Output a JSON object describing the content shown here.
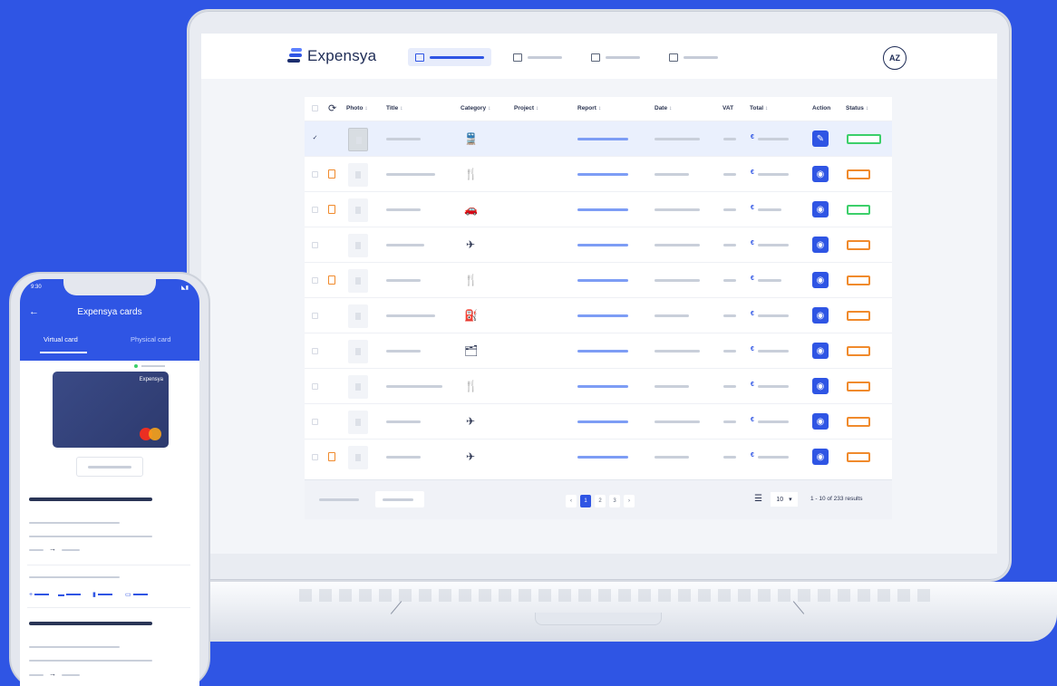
{
  "app": {
    "brand": "Expensya",
    "user_initials": "AZ"
  },
  "colors": {
    "background": "#2f55e4",
    "accent": "#2f55e4",
    "status_pending": "#f08a2c",
    "status_approved": "#3ccf6a"
  },
  "nav": {
    "items": [
      {
        "icon": "expenses-icon",
        "active": true
      },
      {
        "icon": "reports-icon",
        "active": false
      },
      {
        "icon": "cards-icon",
        "active": false
      },
      {
        "icon": "documents-icon",
        "active": false
      }
    ]
  },
  "table": {
    "columns": {
      "photo": "Photo",
      "title": "Title",
      "category": "Category",
      "project": "Project",
      "report": "Report",
      "date": "Date",
      "vat": "VAT",
      "total": "Total",
      "action": "Action",
      "status": "Status"
    },
    "sort_glyph": "↕",
    "rows": [
      {
        "selected": true,
        "duplicate": false,
        "photo": "receipt",
        "category_icon": "🚆",
        "category": "train-icon",
        "action": "✎",
        "action_icon": "edit-icon",
        "status": "approved-wide"
      },
      {
        "selected": false,
        "duplicate": true,
        "photo": "placeholder",
        "category_icon": "🍴",
        "category": "restaurant-icon",
        "action": "◉",
        "action_icon": "view-icon",
        "status": "pending"
      },
      {
        "selected": false,
        "duplicate": true,
        "photo": "placeholder",
        "category_icon": "🚗",
        "category": "car-icon",
        "action": "◉",
        "action_icon": "view-icon",
        "status": "approved"
      },
      {
        "selected": false,
        "duplicate": false,
        "photo": "placeholder",
        "category_icon": "✈",
        "category": "flight-icon",
        "action": "◉",
        "action_icon": "view-icon",
        "status": "pending"
      },
      {
        "selected": false,
        "duplicate": true,
        "photo": "placeholder",
        "category_icon": "🍴",
        "category": "restaurant-icon",
        "action": "◉",
        "action_icon": "view-icon",
        "status": "pending"
      },
      {
        "selected": false,
        "duplicate": false,
        "photo": "placeholder",
        "category_icon": "⛽",
        "category": "fuel-icon",
        "action": "◉",
        "action_icon": "view-icon",
        "status": "pending"
      },
      {
        "selected": false,
        "duplicate": false,
        "photo": "placeholder",
        "category_icon": "🗂",
        "category": "office-icon",
        "action": "◉",
        "action_icon": "view-icon",
        "status": "pending"
      },
      {
        "selected": false,
        "duplicate": false,
        "photo": "placeholder",
        "category_icon": "🍴",
        "category": "restaurant-icon",
        "action": "◉",
        "action_icon": "view-icon",
        "status": "pending"
      },
      {
        "selected": false,
        "duplicate": false,
        "photo": "placeholder",
        "category_icon": "✈",
        "category": "flight-icon",
        "action": "◉",
        "action_icon": "view-icon",
        "status": "pending"
      },
      {
        "selected": false,
        "duplicate": true,
        "photo": "placeholder",
        "category_icon": "✈",
        "category": "flight-icon",
        "action": "◉",
        "action_icon": "view-icon",
        "status": "pending"
      }
    ]
  },
  "pagination": {
    "prev": "‹",
    "pages": [
      "1",
      "2",
      "3"
    ],
    "current_page": "1",
    "next": "›",
    "per_page": "10",
    "per_page_caret": "▾",
    "results": "1 - 10 of 233 results"
  },
  "phone": {
    "time": "9:30",
    "title": "Expensya cards",
    "tabs": {
      "virtual": "Virtual card",
      "physical": "Physical card"
    },
    "card_brand": "Expensya"
  }
}
